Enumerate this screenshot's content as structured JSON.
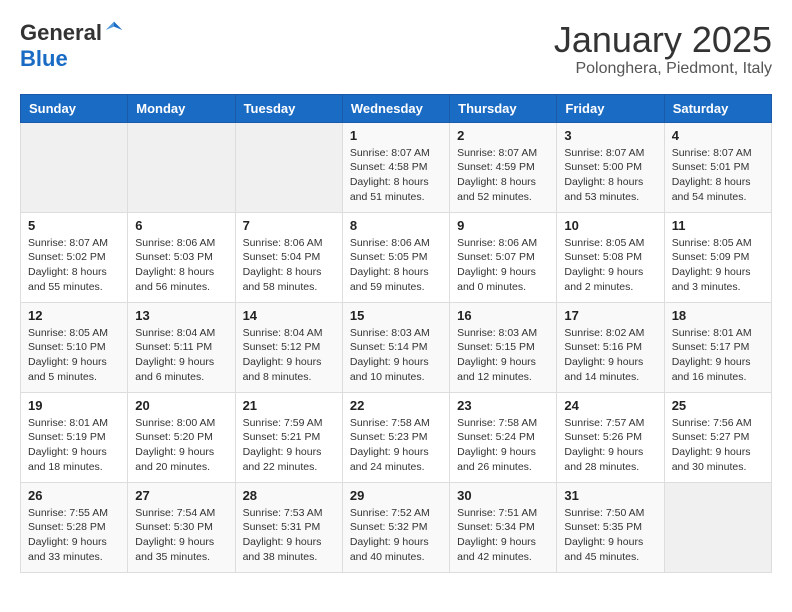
{
  "logo": {
    "general": "General",
    "blue": "Blue"
  },
  "header": {
    "month": "January 2025",
    "location": "Polonghera, Piedmont, Italy"
  },
  "weekdays": [
    "Sunday",
    "Monday",
    "Tuesday",
    "Wednesday",
    "Thursday",
    "Friday",
    "Saturday"
  ],
  "weeks": [
    [
      {
        "num": "",
        "info": ""
      },
      {
        "num": "",
        "info": ""
      },
      {
        "num": "",
        "info": ""
      },
      {
        "num": "1",
        "info": "Sunrise: 8:07 AM\nSunset: 4:58 PM\nDaylight: 8 hours\nand 51 minutes."
      },
      {
        "num": "2",
        "info": "Sunrise: 8:07 AM\nSunset: 4:59 PM\nDaylight: 8 hours\nand 52 minutes."
      },
      {
        "num": "3",
        "info": "Sunrise: 8:07 AM\nSunset: 5:00 PM\nDaylight: 8 hours\nand 53 minutes."
      },
      {
        "num": "4",
        "info": "Sunrise: 8:07 AM\nSunset: 5:01 PM\nDaylight: 8 hours\nand 54 minutes."
      }
    ],
    [
      {
        "num": "5",
        "info": "Sunrise: 8:07 AM\nSunset: 5:02 PM\nDaylight: 8 hours\nand 55 minutes."
      },
      {
        "num": "6",
        "info": "Sunrise: 8:06 AM\nSunset: 5:03 PM\nDaylight: 8 hours\nand 56 minutes."
      },
      {
        "num": "7",
        "info": "Sunrise: 8:06 AM\nSunset: 5:04 PM\nDaylight: 8 hours\nand 58 minutes."
      },
      {
        "num": "8",
        "info": "Sunrise: 8:06 AM\nSunset: 5:05 PM\nDaylight: 8 hours\nand 59 minutes."
      },
      {
        "num": "9",
        "info": "Sunrise: 8:06 AM\nSunset: 5:07 PM\nDaylight: 9 hours\nand 0 minutes."
      },
      {
        "num": "10",
        "info": "Sunrise: 8:05 AM\nSunset: 5:08 PM\nDaylight: 9 hours\nand 2 minutes."
      },
      {
        "num": "11",
        "info": "Sunrise: 8:05 AM\nSunset: 5:09 PM\nDaylight: 9 hours\nand 3 minutes."
      }
    ],
    [
      {
        "num": "12",
        "info": "Sunrise: 8:05 AM\nSunset: 5:10 PM\nDaylight: 9 hours\nand 5 minutes."
      },
      {
        "num": "13",
        "info": "Sunrise: 8:04 AM\nSunset: 5:11 PM\nDaylight: 9 hours\nand 6 minutes."
      },
      {
        "num": "14",
        "info": "Sunrise: 8:04 AM\nSunset: 5:12 PM\nDaylight: 9 hours\nand 8 minutes."
      },
      {
        "num": "15",
        "info": "Sunrise: 8:03 AM\nSunset: 5:14 PM\nDaylight: 9 hours\nand 10 minutes."
      },
      {
        "num": "16",
        "info": "Sunrise: 8:03 AM\nSunset: 5:15 PM\nDaylight: 9 hours\nand 12 minutes."
      },
      {
        "num": "17",
        "info": "Sunrise: 8:02 AM\nSunset: 5:16 PM\nDaylight: 9 hours\nand 14 minutes."
      },
      {
        "num": "18",
        "info": "Sunrise: 8:01 AM\nSunset: 5:17 PM\nDaylight: 9 hours\nand 16 minutes."
      }
    ],
    [
      {
        "num": "19",
        "info": "Sunrise: 8:01 AM\nSunset: 5:19 PM\nDaylight: 9 hours\nand 18 minutes."
      },
      {
        "num": "20",
        "info": "Sunrise: 8:00 AM\nSunset: 5:20 PM\nDaylight: 9 hours\nand 20 minutes."
      },
      {
        "num": "21",
        "info": "Sunrise: 7:59 AM\nSunset: 5:21 PM\nDaylight: 9 hours\nand 22 minutes."
      },
      {
        "num": "22",
        "info": "Sunrise: 7:58 AM\nSunset: 5:23 PM\nDaylight: 9 hours\nand 24 minutes."
      },
      {
        "num": "23",
        "info": "Sunrise: 7:58 AM\nSunset: 5:24 PM\nDaylight: 9 hours\nand 26 minutes."
      },
      {
        "num": "24",
        "info": "Sunrise: 7:57 AM\nSunset: 5:26 PM\nDaylight: 9 hours\nand 28 minutes."
      },
      {
        "num": "25",
        "info": "Sunrise: 7:56 AM\nSunset: 5:27 PM\nDaylight: 9 hours\nand 30 minutes."
      }
    ],
    [
      {
        "num": "26",
        "info": "Sunrise: 7:55 AM\nSunset: 5:28 PM\nDaylight: 9 hours\nand 33 minutes."
      },
      {
        "num": "27",
        "info": "Sunrise: 7:54 AM\nSunset: 5:30 PM\nDaylight: 9 hours\nand 35 minutes."
      },
      {
        "num": "28",
        "info": "Sunrise: 7:53 AM\nSunset: 5:31 PM\nDaylight: 9 hours\nand 38 minutes."
      },
      {
        "num": "29",
        "info": "Sunrise: 7:52 AM\nSunset: 5:32 PM\nDaylight: 9 hours\nand 40 minutes."
      },
      {
        "num": "30",
        "info": "Sunrise: 7:51 AM\nSunset: 5:34 PM\nDaylight: 9 hours\nand 42 minutes."
      },
      {
        "num": "31",
        "info": "Sunrise: 7:50 AM\nSunset: 5:35 PM\nDaylight: 9 hours\nand 45 minutes."
      },
      {
        "num": "",
        "info": ""
      }
    ]
  ]
}
